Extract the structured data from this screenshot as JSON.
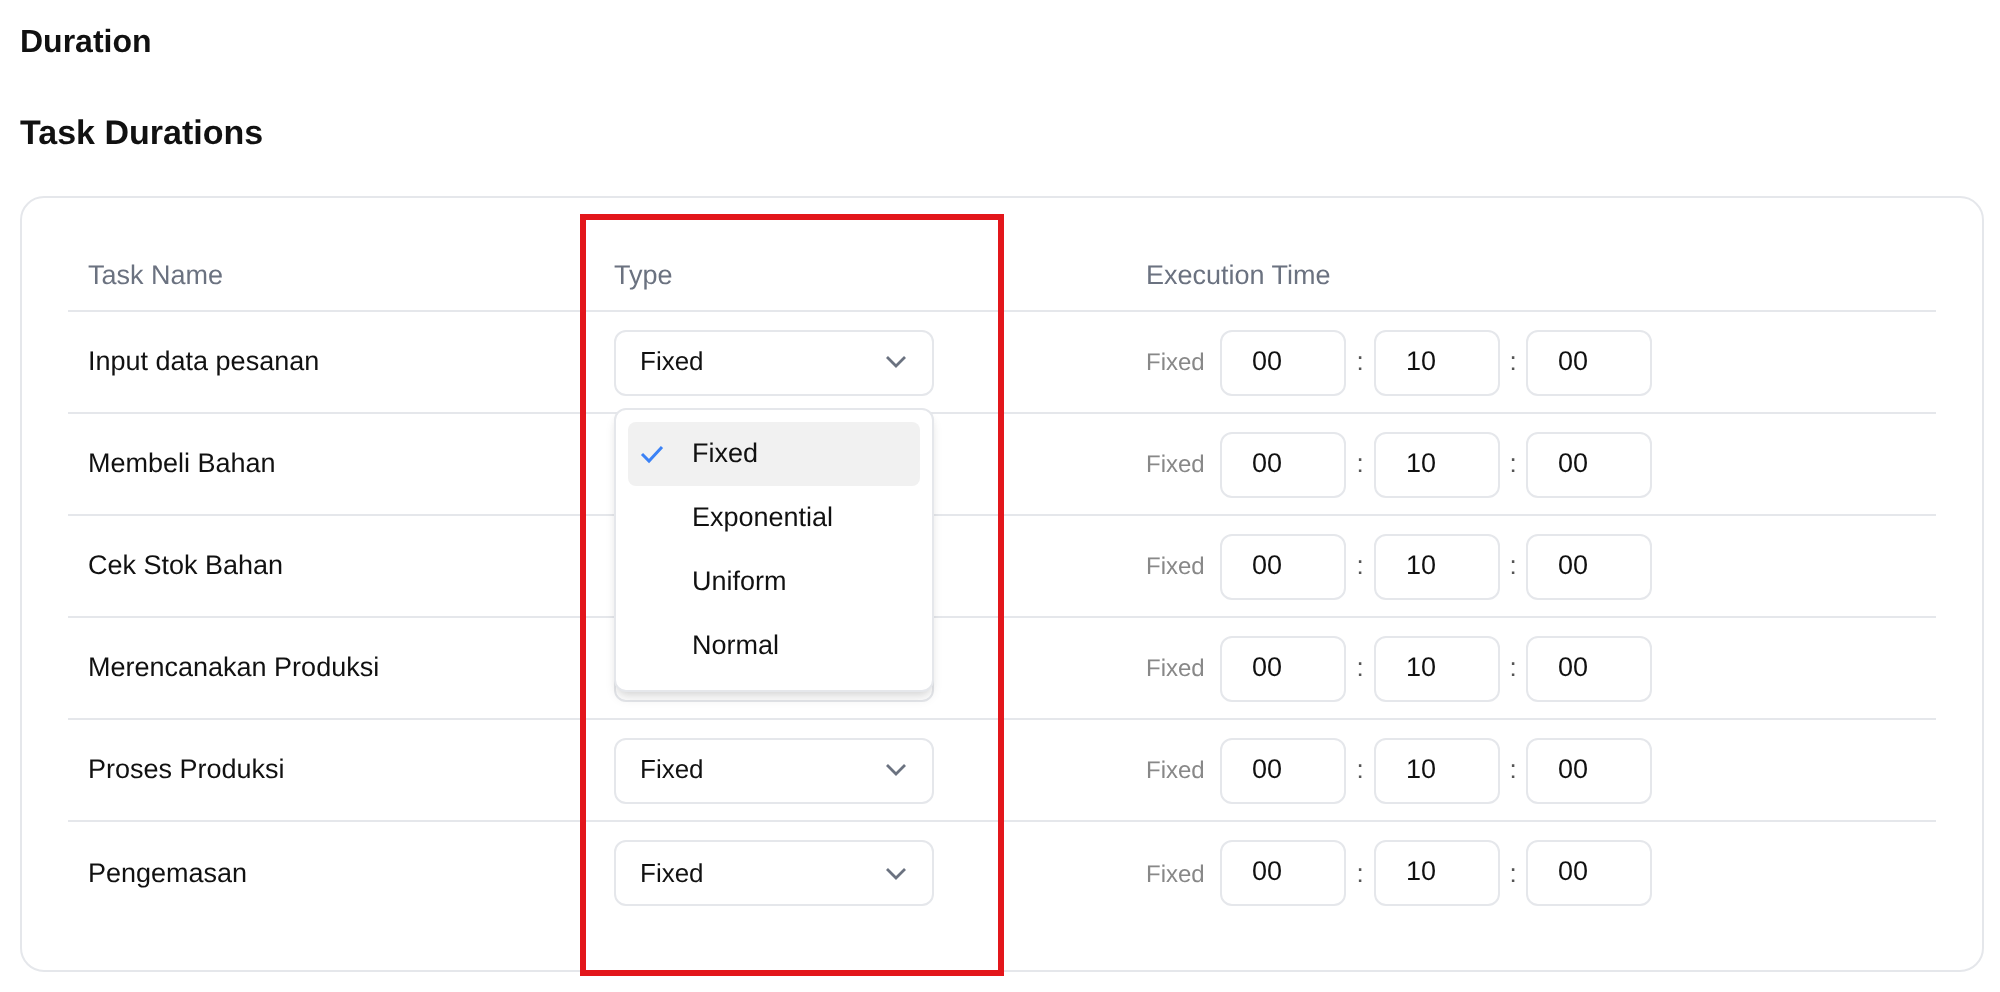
{
  "page_title": "Duration",
  "section_title": "Task Durations",
  "table": {
    "columns": [
      "Task Name",
      "Type",
      "Execution Time"
    ],
    "rows": [
      {
        "name": "Input data pesanan",
        "type": "Fixed",
        "time_label": "Fixed",
        "hours": "00",
        "minutes": "10",
        "seconds": "00"
      },
      {
        "name": "Membeli Bahan",
        "time_label": "Fixed",
        "hours": "00",
        "minutes": "10",
        "seconds": "00"
      },
      {
        "name": "Cek Stok Bahan",
        "time_label": "Fixed",
        "hours": "00",
        "minutes": "10",
        "seconds": "00"
      },
      {
        "name": "Merencanakan Produksi",
        "time_label": "Fixed",
        "hours": "00",
        "minutes": "10",
        "seconds": "00"
      },
      {
        "name": "Proses Produksi",
        "type": "Fixed",
        "time_label": "Fixed",
        "hours": "00",
        "minutes": "10",
        "seconds": "00"
      },
      {
        "name": "Pengemasan",
        "type": "Fixed",
        "time_label": "Fixed",
        "hours": "00",
        "minutes": "10",
        "seconds": "00"
      }
    ],
    "separator": ":"
  },
  "dropdown": {
    "options": [
      {
        "label": "Fixed",
        "selected": true
      },
      {
        "label": "Exponential",
        "selected": false
      },
      {
        "label": "Uniform",
        "selected": false
      },
      {
        "label": "Normal",
        "selected": false
      }
    ]
  }
}
